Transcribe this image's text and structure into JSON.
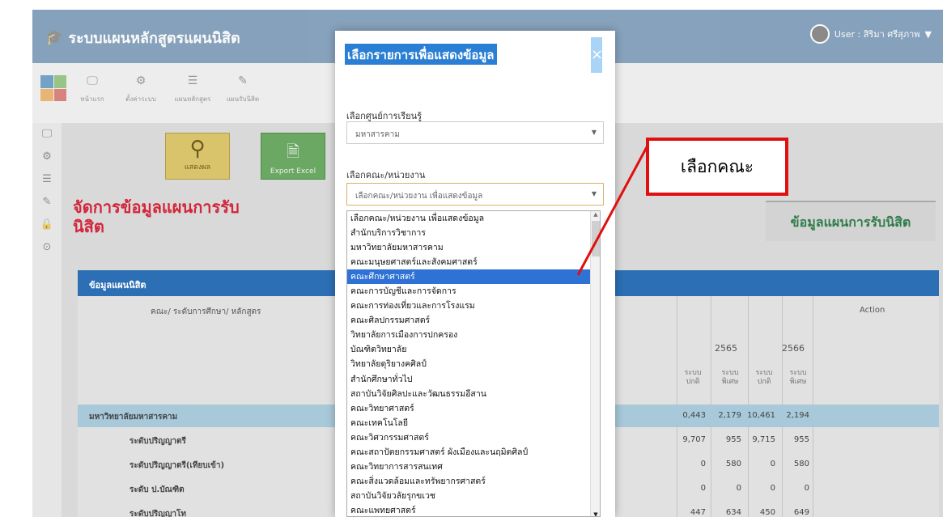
{
  "header": {
    "brand": "ระบบแผนหลักสูตรแผนนิสิต",
    "user": "User : สิริมา ศรีสุภาพ"
  },
  "toolbar": {
    "items": [
      "หน้าแรก",
      "ตั้งค่าระบบ",
      "แผนหลักสูตร",
      "แผนรับนิสิต"
    ]
  },
  "buttons": {
    "show": "แสดงผล",
    "export": "Export Excel"
  },
  "page": {
    "title": "จัดการข้อมูลแผนการรับนิสิต",
    "right_title": "ข้อมูลแผนการรับนิสิต"
  },
  "table": {
    "section": "ข้อมูลแผนนิสิต",
    "col_faculty": "คณะ/ ระดับการศึกษา/ หลักสูตร",
    "col_action": "Action",
    "years": [
      "2565",
      "2566"
    ],
    "sub": [
      "ระบบ ปกติ",
      "ระบบ พิเศษ",
      "ระบบ ปกติ",
      "ระบบ พิเศษ"
    ],
    "rows": [
      {
        "label": "มหาวิทยาลัยมหาสารคาม",
        "values": [
          "0,443",
          "2,179",
          "10,461",
          "2,194"
        ]
      },
      {
        "label": "ระดับปริญญาตรี",
        "values": [
          "9,707",
          "955",
          "9,715",
          "955"
        ]
      },
      {
        "label": "ระดับปริญญาตรี(เทียบเข้า)",
        "values": [
          "0",
          "580",
          "0",
          "580"
        ]
      },
      {
        "label": "ระดับ ป.บัณฑิต",
        "values": [
          "0",
          "0",
          "0",
          "0"
        ]
      },
      {
        "label": "ระดับปริญญาโท",
        "values": [
          "447",
          "634",
          "450",
          "649"
        ]
      }
    ]
  },
  "modal": {
    "title": "เลือกรายการเพื่อแสดงข้อมูล",
    "close": "×",
    "center_label": "เลือกศูนย์การเรียนรู้",
    "center_value": "มหาสารคาม",
    "faculty_label": "เลือกคณะ/หน่วยงาน",
    "faculty_value": "เลือกคณะ/หน่วยงาน เพื่อแสดงข้อมูล",
    "options": [
      "เลือกคณะ/หน่วยงาน เพื่อแสดงข้อมูล",
      "สำนักบริการวิชาการ",
      "มหาวิทยาลัยมหาสารคาม",
      "คณะมนุษยศาสตร์และสังคมศาสตร์",
      "คณะศึกษาศาสตร์",
      "คณะการบัญชีและการจัดการ",
      "คณะการท่องเที่ยวและการโรงแรม",
      "คณะศิลปกรรมศาสตร์",
      "วิทยาลัยการเมืองการปกครอง",
      "บัณฑิตวิทยาลัย",
      "วิทยาลัยดุริยางคศิลป์",
      "สำนักศึกษาทั่วไป",
      "สถาบันวิจัยศิลปะและวัฒนธรรมอีสาน",
      "คณะวิทยาศาสตร์",
      "คณะเทคโนโลยี",
      "คณะวิศวกรรมศาสตร์",
      "คณะสถาปัตยกรรมศาสตร์ ผังเมืองและนฤมิตศิลป์",
      "คณะวิทยาการสารสนเทศ",
      "คณะสิ่งแวดล้อมและทรัพยากรศาสตร์",
      "สถาบันวิจัยวลัยรุกขเวช",
      "คณะแพทยศาสตร์"
    ],
    "selected_index": 4
  },
  "callout": "เลือกคณะ"
}
